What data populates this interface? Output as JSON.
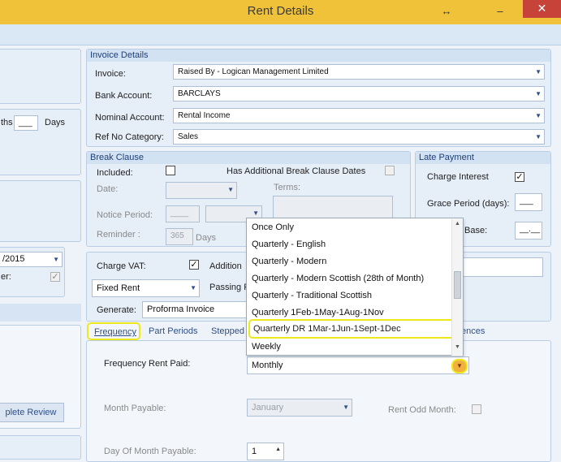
{
  "window": {
    "title": "Rent Details",
    "resize_glyph": "↔",
    "min_glyph": "‒",
    "close_glyph": "✕"
  },
  "left": {
    "days_fragment": "ths",
    "days_value": "___",
    "days_label": "Days",
    "date_value": "/2015",
    "er_label": "er:",
    "review_button": "plete Review"
  },
  "invoice": {
    "header": "Invoice Details",
    "invoice_label": "Invoice:",
    "invoice_value": "Raised By - Logican Management Limited",
    "bank_label": "Bank Account:",
    "bank_value": "BARCLAYS",
    "nominal_label": "Nominal Account:",
    "nominal_value": "Rental Income",
    "refno_label": "Ref No Category:",
    "refno_value": "Sales"
  },
  "break_clause": {
    "header": "Break Clause",
    "included_label": "Included:",
    "additional_label": "Has Additional Break Clause Dates",
    "date_label": "Date:",
    "terms_label": "Terms:",
    "notice_label": "Notice Period:",
    "notice_value": "____",
    "reminder_label": "Reminder :",
    "reminder_value": "365",
    "reminder_unit": "Days"
  },
  "late_payment": {
    "header": "Late Payment",
    "charge_label": "Charge Interest",
    "grace_label": "Grace Period (days):",
    "grace_value": "___",
    "base_label": "Base:",
    "base_value": "__.__"
  },
  "vat": {
    "charge_vat_label": "Charge VAT:",
    "addition_label": "Addition",
    "rent_type": "Fixed Rent",
    "passing_label": "Passing R",
    "generate_label": "Generate:",
    "generate_value": "Proforma Invoice"
  },
  "tabs": {
    "frequency": "Frequency",
    "part_periods": "Part Periods",
    "stepped": "Stepped",
    "references": "ences"
  },
  "frequency": {
    "paid_label": "Frequency Rent Paid:",
    "paid_value": "Monthly",
    "month_label": "Month Payable:",
    "month_value": "January",
    "odd_label": "Rent Odd Month:",
    "day_label": "Day Of Month Payable:",
    "day_value": "1"
  },
  "dropdown_options": [
    "Once Only",
    "Quarterly - English",
    "Quarterly - Modern",
    "Quarterly - Modern Scottish (28th of Month)",
    "Quarterly - Traditional Scottish",
    "Quarterly 1Feb-1May-1Aug-1Nov",
    "Quarterly DR 1Mar-1Jun-1Sept-1Dec",
    "Weekly"
  ],
  "colors": {
    "titlebar": "#f0c23a",
    "highlight": "#ede81a",
    "header_text": "#1c3f78",
    "close": "#c7433a"
  }
}
